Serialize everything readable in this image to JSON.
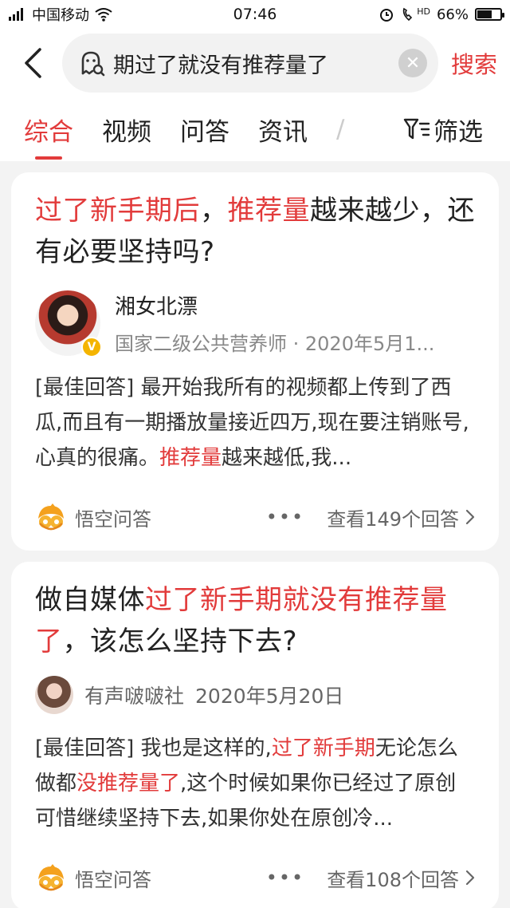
{
  "status_bar": {
    "carrier": "中国移动",
    "time": "07:46",
    "hd_label": "HD",
    "battery": "66%",
    "battery_level": 0.66
  },
  "search": {
    "query": "期过了就没有推荐量了",
    "button_label": "搜索"
  },
  "tabs": [
    {
      "label": "综合"
    },
    {
      "label": "视频"
    },
    {
      "label": "问答"
    },
    {
      "label": "资讯"
    },
    {
      "label": "/"
    }
  ],
  "filter_label": "筛选",
  "cards": [
    {
      "title_parts": [
        "过了新手期后",
        "，",
        "推荐量",
        "越来越少，还有必要坚持吗?"
      ],
      "author_name": "湘女北漂",
      "author_meta": "国家二级公共营养师 · 2020年5月1...",
      "verified_badge": "V",
      "excerpt_parts": [
        "[最佳回答] 最开始我所有的视频都上传到了西瓜,而且有一期播放量接近四万,现在要注销账号,心真的很痛。",
        "推荐量",
        "越来越低,我..."
      ],
      "source": "悟空问答",
      "more": "•••",
      "answers": "查看149个回答"
    },
    {
      "title_parts": [
        "做自媒体",
        "过了新手期就没有推荐量了",
        "，该怎么坚持下去?"
      ],
      "author_name": "有声啵啵社",
      "date": "2020年5月20日",
      "excerpt_parts": [
        "[最佳回答] 我也是这样的,",
        "过了新手期",
        "无论怎么做都",
        "没推荐量了",
        ",这个时候如果你已经过了原创可惜继续坚持下去,如果你处在原创冷..."
      ],
      "source": "悟空问答",
      "more": "•••",
      "answers": "查看108个回答"
    }
  ],
  "colors": {
    "accent": "#e23b3b",
    "text": "#222222",
    "muted": "#888888",
    "background": "#f3f3f3"
  }
}
